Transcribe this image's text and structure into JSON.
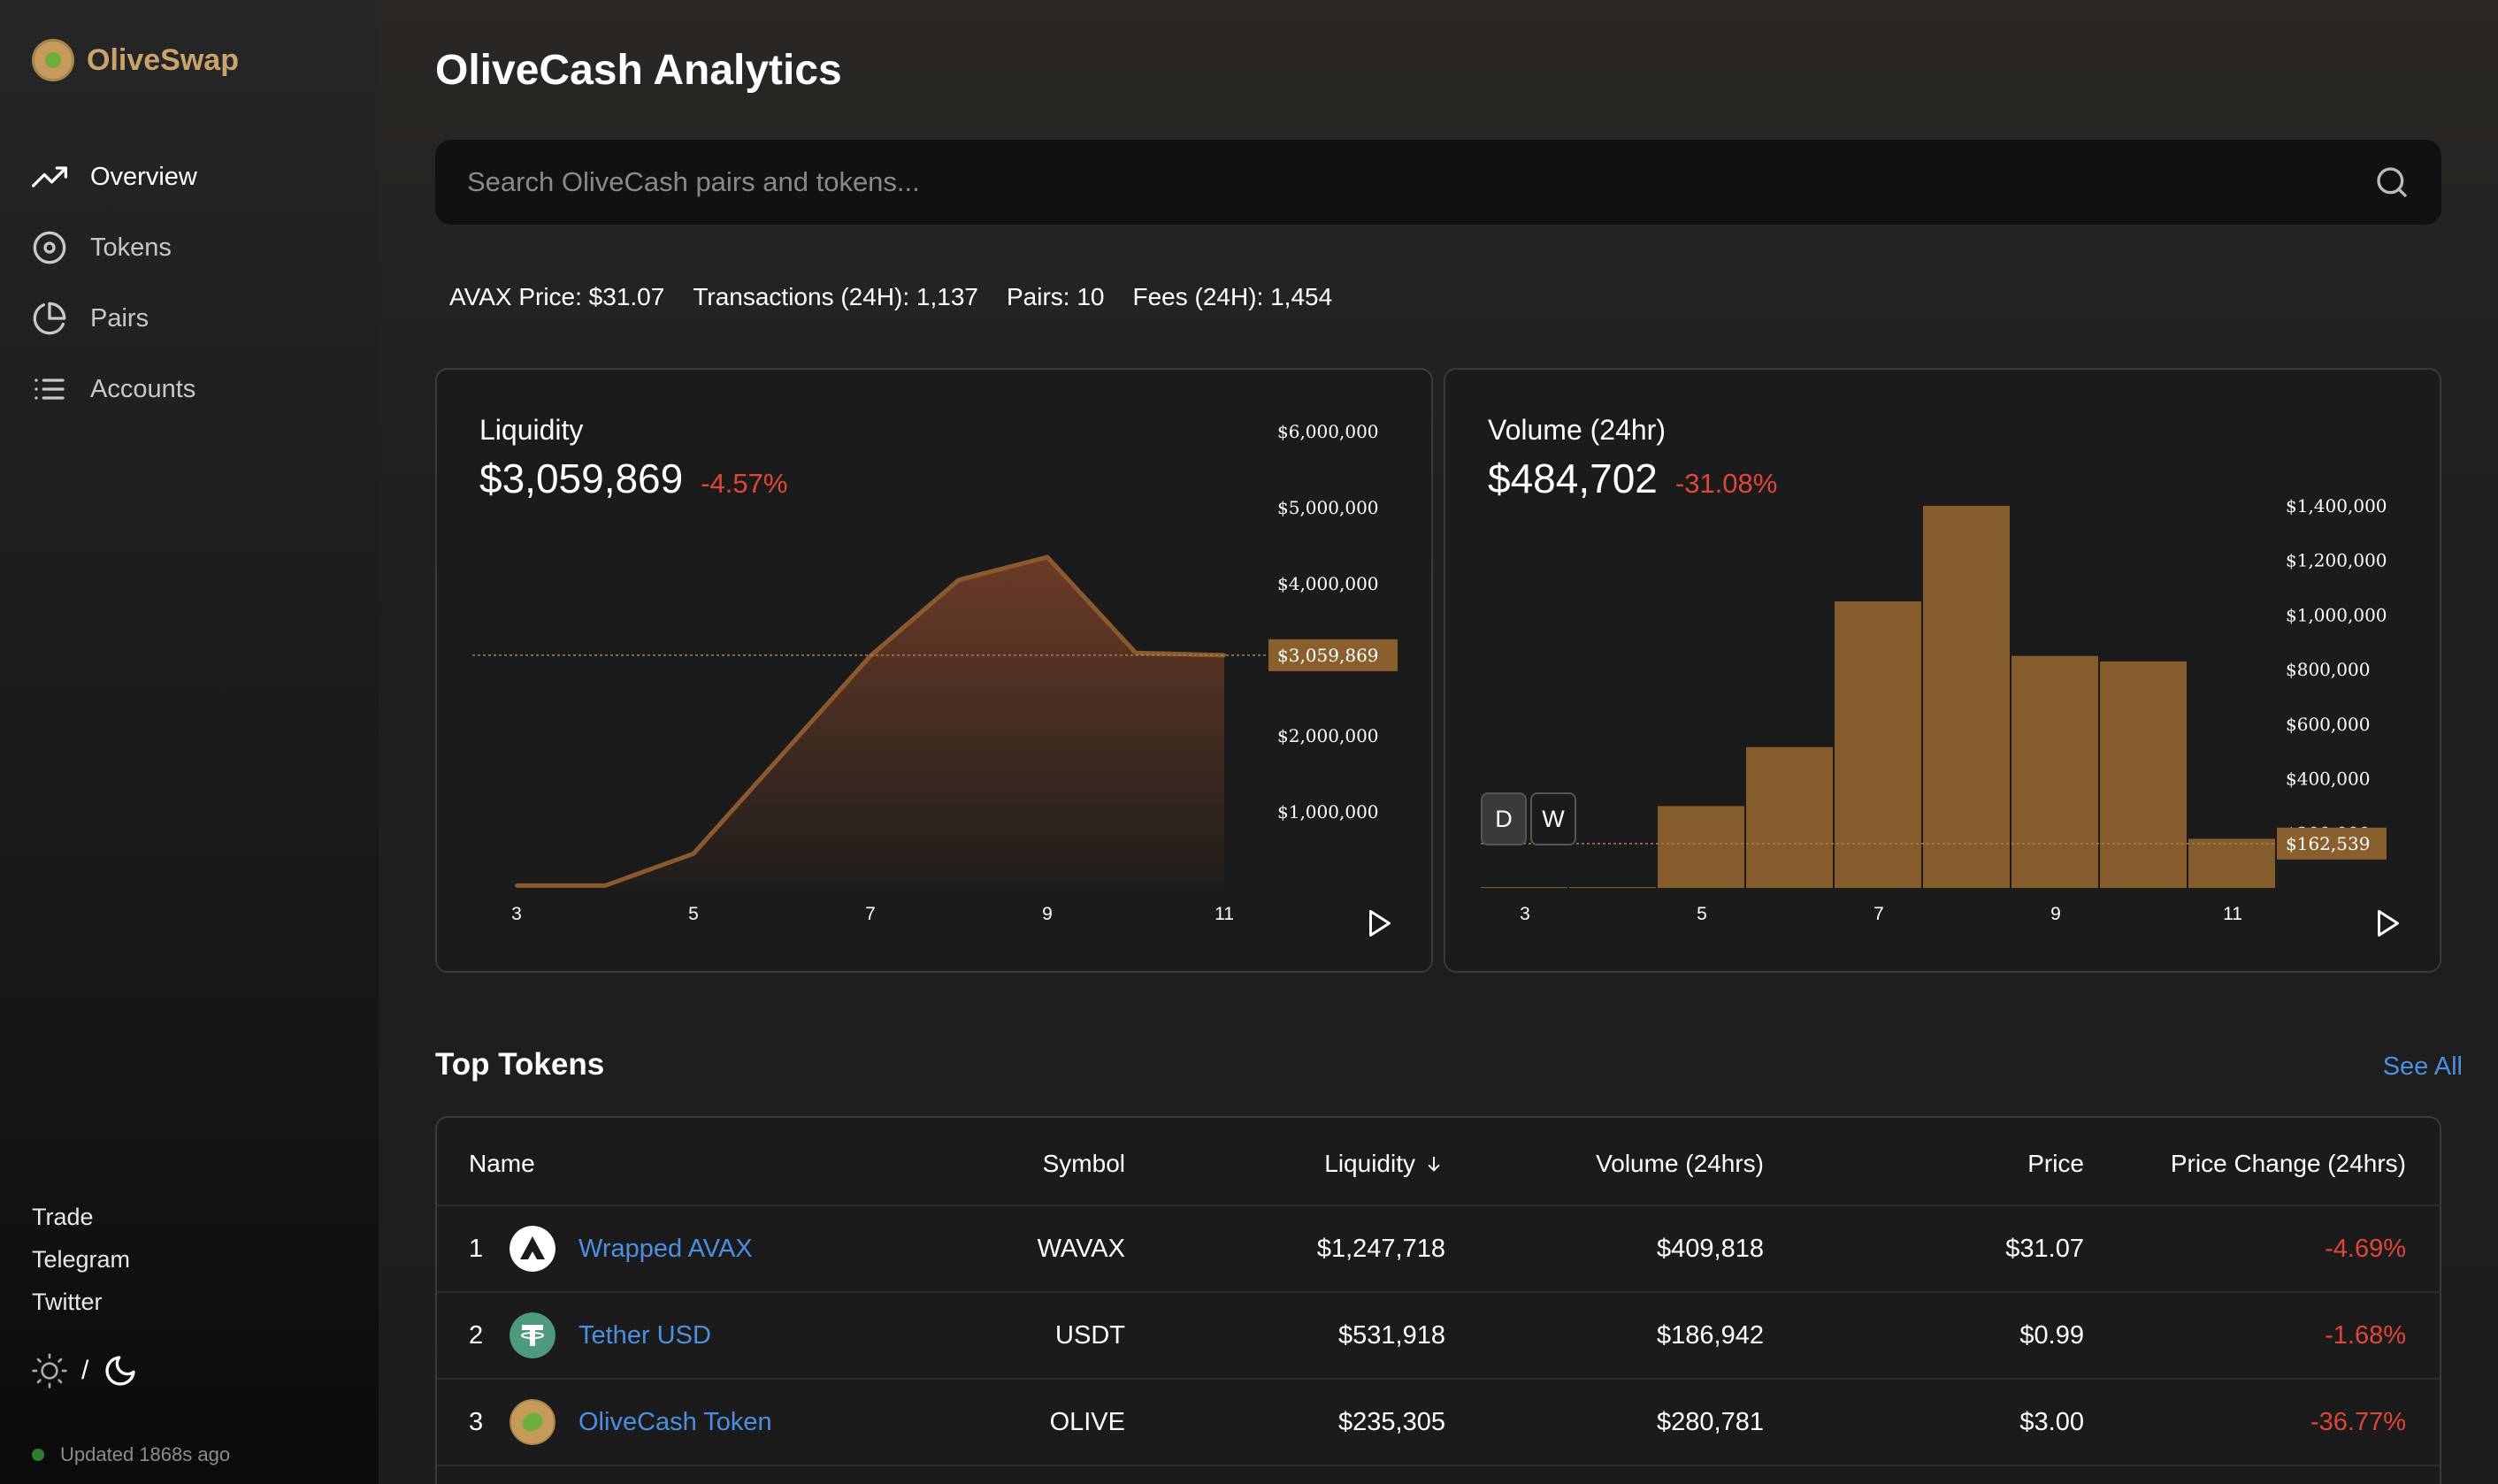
{
  "brand": {
    "name": "OliveSwap"
  },
  "sidebar": {
    "nav": [
      {
        "label": "Overview",
        "icon": "trending-up-icon",
        "active": true
      },
      {
        "label": "Tokens",
        "icon": "disc-icon",
        "active": false
      },
      {
        "label": "Pairs",
        "icon": "pie-chart-icon",
        "active": false
      },
      {
        "label": "Accounts",
        "icon": "list-icon",
        "active": false
      }
    ],
    "links": [
      "Trade",
      "Telegram",
      "Twitter"
    ],
    "theme_separator": "/",
    "updated": "Updated 1868s ago"
  },
  "page": {
    "title": "OliveCash Analytics"
  },
  "search": {
    "placeholder": "Search OliveCash pairs and tokens..."
  },
  "stats": {
    "avax_price": "AVAX Price: $31.07",
    "transactions": "Transactions (24H): 1,137",
    "pairs": "Pairs: 10",
    "fees": "Fees (24H): 1,454"
  },
  "liquidity_card": {
    "title": "Liquidity",
    "value": "$3,059,869",
    "change": "-4.57%",
    "current_label": "$3,059,869"
  },
  "volume_card": {
    "title": "Volume (24hr)",
    "value": "$484,702",
    "change": "-31.08%",
    "current_label": "$162,539",
    "toggle": [
      "D",
      "W"
    ]
  },
  "chart_data": [
    {
      "type": "area",
      "title": "Liquidity",
      "x": [
        3,
        4,
        5,
        6,
        7,
        8,
        9,
        10,
        11
      ],
      "series": [
        {
          "values": [
            30000,
            30000,
            450000,
            1750000,
            3050000,
            4050000,
            4350000,
            3090000,
            3059869
          ]
        }
      ],
      "x_ticks": [
        "3",
        "5",
        "7",
        "9",
        "11"
      ],
      "y_ticks": [
        "$1,000,000",
        "$2,000,000",
        "$3,000,000",
        "$4,000,000",
        "$5,000,000",
        "$6,000,000"
      ],
      "ylim": [
        0,
        6000000
      ],
      "current_value": 3059869,
      "color": "#8a5a2e"
    },
    {
      "type": "bar",
      "title": "Volume (24hr)",
      "x": [
        3,
        4,
        5,
        6,
        7,
        8,
        9,
        10,
        11,
        12
      ],
      "values": [
        3000,
        3000,
        300000,
        516000,
        1050000,
        1400000,
        850000,
        830000,
        180000,
        162539
      ],
      "x_ticks": [
        "3",
        "5",
        "7",
        "9",
        "11"
      ],
      "y_ticks": [
        "$200,000",
        "$400,000",
        "$600,000",
        "$800,000",
        "$1,000,000",
        "$1,200,000",
        "$1,400,000"
      ],
      "ylim": [
        0,
        1400000
      ],
      "current_value": 162539,
      "color": "#855d2d"
    }
  ],
  "top_tokens": {
    "title": "Top Tokens",
    "see_all": "See All",
    "columns": [
      "Name",
      "Symbol",
      "Liquidity",
      "Volume (24hrs)",
      "Price",
      "Price Change (24hrs)"
    ],
    "rows": [
      {
        "rank": "1",
        "name": "Wrapped AVAX",
        "icon": "avax-icon",
        "symbol": "WAVAX",
        "liquidity": "$1,247,718",
        "volume": "$409,818",
        "price": "$31.07",
        "change": "-4.69%"
      },
      {
        "rank": "2",
        "name": "Tether USD",
        "icon": "tether-icon",
        "symbol": "USDT",
        "liquidity": "$531,918",
        "volume": "$186,942",
        "price": "$0.99",
        "change": "-1.68%"
      },
      {
        "rank": "3",
        "name": "OliveCash Token",
        "icon": "olive-icon",
        "symbol": "OLIVE",
        "liquidity": "$235,305",
        "volume": "$280,781",
        "price": "$3.00",
        "change": "-36.77%"
      }
    ]
  }
}
